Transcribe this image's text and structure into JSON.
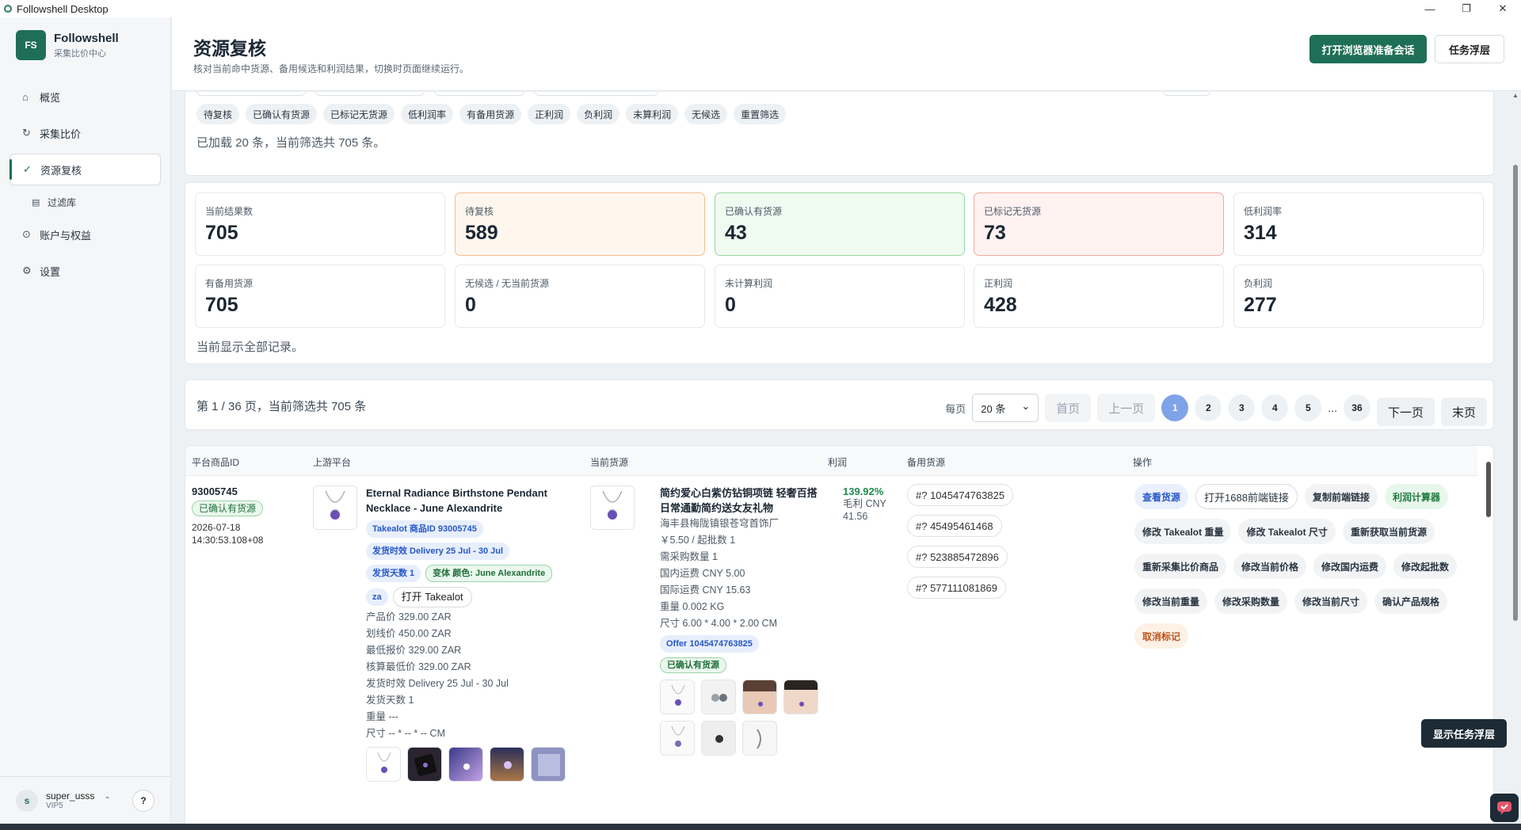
{
  "window": {
    "title": "Followshell Desktop",
    "controls": [
      "—",
      "❐",
      "✕"
    ]
  },
  "brand": {
    "logo": "FS",
    "name": "Followshell",
    "subtitle": "采集比价中心"
  },
  "nav": {
    "overview": "概览",
    "collect": "采集比价",
    "review": "资源复核",
    "filter_lib": "过滤库",
    "account": "账户与权益",
    "settings": "设置"
  },
  "user": {
    "avatar": "s",
    "name": "super_usss",
    "tier": "VIP5",
    "help": "?"
  },
  "header": {
    "title": "资源复核",
    "subtitle": "核对当前命中货源、备用候选和利润结果，切换时页面继续运行。",
    "primary_button": "打开浏览器准备会话",
    "task_button": "任务浮层"
  },
  "filters": {
    "chips": [
      "待复核",
      "已确认有货源",
      "已标记无货源",
      "低利润率",
      "有备用货源",
      "正利润",
      "负利润",
      "未算利润",
      "无候选",
      "重置筛选"
    ],
    "note": "已加载 20 条，当前筛选共 705 条。"
  },
  "stats": {
    "items": [
      {
        "label": "当前结果数",
        "value": "705",
        "tone": "plain"
      },
      {
        "label": "待复核",
        "value": "589",
        "tone": "orange"
      },
      {
        "label": "已确认有货源",
        "value": "43",
        "tone": "green"
      },
      {
        "label": "已标记无货源",
        "value": "73",
        "tone": "red"
      },
      {
        "label": "低利润率",
        "value": "314",
        "tone": "plain"
      },
      {
        "label": "有备用货源",
        "value": "705",
        "tone": "plain"
      },
      {
        "label": "无候选 / 无当前货源",
        "value": "0",
        "tone": "plain"
      },
      {
        "label": "未计算利润",
        "value": "0",
        "tone": "plain"
      },
      {
        "label": "正利润",
        "value": "428",
        "tone": "plain"
      },
      {
        "label": "负利润",
        "value": "277",
        "tone": "plain"
      }
    ],
    "note": "当前显示全部记录。"
  },
  "pager": {
    "info": "第 1 / 36 页，当前筛选共 705 条",
    "per_page_label": "每页",
    "per_page": "20 条",
    "first": "首页",
    "prev": "上一页",
    "pages": [
      "1",
      "2",
      "3",
      "4",
      "5"
    ],
    "ellipsis": "...",
    "last_page": "36",
    "next": "下一页",
    "last": "末页"
  },
  "table": {
    "headers": {
      "pid": "平台商品ID",
      "upstream": "上游平台",
      "source": "当前货源",
      "profit": "利润",
      "alternates": "备用货源",
      "actions": "操作"
    },
    "row": {
      "pid": "93005745",
      "status": "已确认有货源",
      "date": "2026-07-18",
      "time": "14:30:53.108+08",
      "up_title": "Eternal Radiance Birthstone Pendant Necklace - June Alexandrite",
      "up_badge_id": "Takealot 商品ID 93005745",
      "up_badge_delivery": "发货时效 Delivery 25 Jul - 30 Jul",
      "up_badge_days": "发货天数 1",
      "up_badge_variant": "变体 颜色: June Alexandrite",
      "up_region": "za",
      "up_open": "打开 Takealot",
      "up_meta": [
        "产品价 329.00 ZAR",
        "划线价 450.00 ZAR",
        "最低报价 329.00 ZAR",
        "核算最低价 329.00 ZAR",
        "发货时效 Delivery 25 Jul - 30 Jul",
        "发货天数 1",
        "重量 ---",
        "尺寸 -- * -- * -- CM"
      ],
      "src_title": "简约爱心白紫仿钻铜项链 轻奢百搭日常通勤简约送女友礼物",
      "src_meta": [
        "海丰县梅陇镇银苍穹首饰厂",
        "￥5.50 / 起批数 1",
        "需采购数量 1",
        "国内运费 CNY 5.00",
        "国际运费 CNY 15.63",
        "重量 0.002 KG",
        "尺寸 6.00 * 4.00 * 2.00 CM"
      ],
      "src_offer": "Offer 1045474763825",
      "src_status": "已确认有货源",
      "profit_pct": "139.92%",
      "profit_gross": "毛利 CNY",
      "profit_val": "41.56",
      "alternates": [
        "#? 1045474763825",
        "#? 45495461468",
        "#? 523885472896",
        "#? 577111081869"
      ],
      "actions": {
        "view": "查看货源",
        "open1688": "打开1688前端链接",
        "copy_link": "复制前端链接",
        "calc": "利润计算器",
        "edit_weight": "修改 Takealot 重量",
        "edit_size": "修改 Takealot 尺寸",
        "refetch": "重新获取当前货源",
        "recollect": "重新采集比价商品",
        "edit_price": "修改当前价格",
        "edit_ship": "修改国内运费",
        "edit_moq": "修改起批数",
        "edit_cur_weight": "修改当前重量",
        "edit_qty": "修改采购数量",
        "edit_cur_size": "修改当前尺寸",
        "confirm_spec": "确认产品规格",
        "unmark": "取消标记"
      }
    }
  },
  "floating": {
    "show_task": "显示任务浮层"
  },
  "colors": {
    "brand": "#1f6f56",
    "orange": "#f3bd8a",
    "green": "#99d6a4",
    "red": "#f0a8a3",
    "page_active": "#7fa3e8"
  }
}
